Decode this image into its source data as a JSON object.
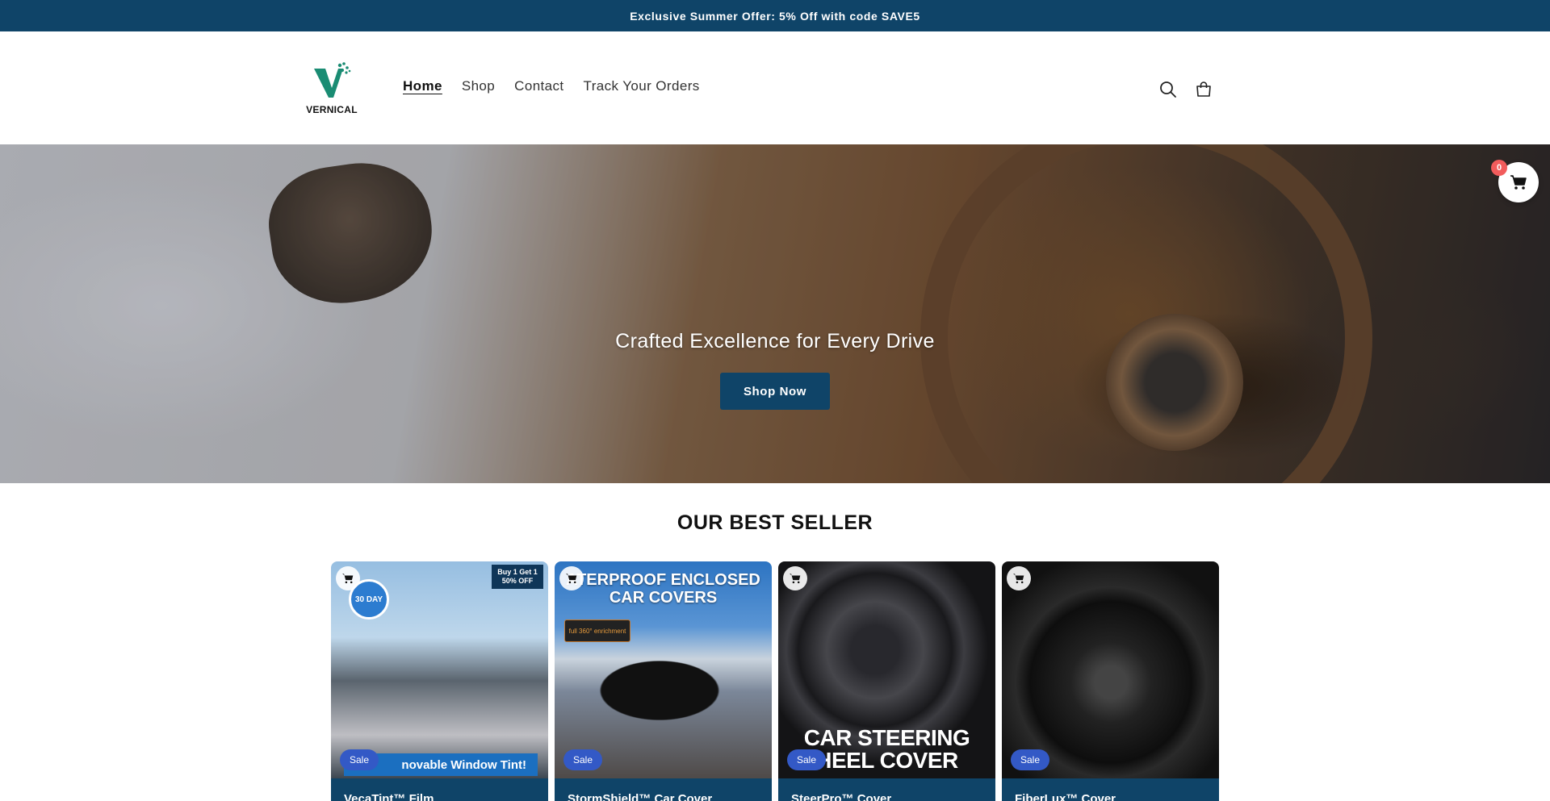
{
  "announcement": "Exclusive Summer Offer: 5% Off with code SAVE5",
  "brand": {
    "name": "VERNICAL",
    "accent": "#0f4468",
    "logo_green": "#1a8c73"
  },
  "nav": [
    {
      "label": "Home"
    },
    {
      "label": "Shop"
    },
    {
      "label": "Contact"
    },
    {
      "label": "Track Your Orders"
    }
  ],
  "header_icons": {
    "search": "search-icon",
    "cart": "cart-icon"
  },
  "hero": {
    "title": "Crafted Excellence for Every Drive",
    "button": "Shop Now"
  },
  "floating_cart": {
    "count": "0",
    "icon": "cart-icon"
  },
  "best_seller": {
    "title": "OUR BEST SELLER",
    "products": [
      {
        "title": "VecaTint™ Film",
        "badge": "Sale",
        "promo": "Buy 1 Get 1 50% OFF",
        "seal": "30 DAY",
        "banner": "novable Window Tint!"
      },
      {
        "title": "StormShield™ Car Cover",
        "badge": "Sale",
        "heading": "ATERPROOF ENCLOSED CAR COVERS",
        "sub": "full 360° enrichment"
      },
      {
        "title": "SteerPro™ Cover",
        "badge": "Sale",
        "heading": "CAR STEERING HEEL COVER"
      },
      {
        "title": "FiberLux™ Cover",
        "badge": "Sale"
      }
    ]
  }
}
